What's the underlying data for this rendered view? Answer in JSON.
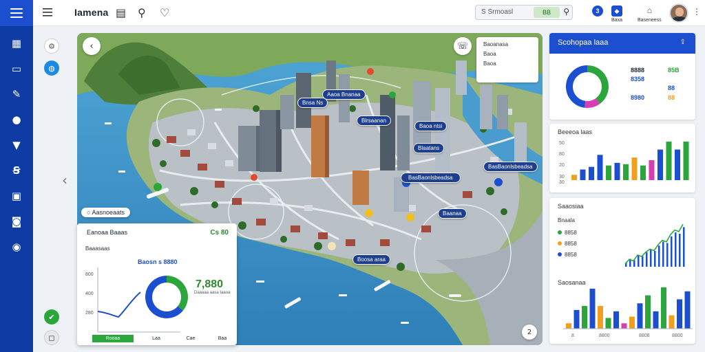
{
  "app": {
    "brand": "Iamena"
  },
  "header": {
    "search_placeholder": "S Srmoasl",
    "search_chip": "BB",
    "btn1_badge": "3",
    "btn2_label": "Baxa",
    "btn3_label": "Baseneess"
  },
  "map": {
    "labels": [
      "Aaoa Bnanaa",
      "Bnsa Ns",
      "Blrsaanan",
      "Baoa ntsi",
      "Blaatans",
      "BasBaonlsbeadsa",
      "Baanaa",
      "Boosa araa"
    ],
    "legend": [
      "Baoanasa",
      "Baoa",
      "Baoa"
    ],
    "tag": "Aasnoeaats",
    "zoom": "2"
  },
  "overlay": {
    "title": "Eanoaa Baaas",
    "value": "Cs 80",
    "subtitle": "Baaasaas",
    "chart_title": "Baosn s 8880",
    "y_ticks": [
      "800",
      "400",
      "280"
    ],
    "big_value": "7,880",
    "big_sub": "Daaaaa aasa taaoa",
    "tabs": [
      "Rooaa",
      "Laa",
      "Cae",
      "Baa"
    ]
  },
  "panel1": {
    "title": "Scohopaa laaa",
    "legend": [
      {
        "v": "8888",
        "c": "#1a1f2b"
      },
      {
        "v": "8358",
        "c": "#1b4fd0"
      },
      {
        "v": "8980",
        "c": "#1b4fd0"
      },
      {
        "v": "85B",
        "c": "#2ca53c"
      },
      {
        "v": "88",
        "c": "#1b4fd0"
      },
      {
        "v": "88",
        "c": "#f0a020"
      }
    ]
  },
  "panel2": {
    "title": "Beeeoa laas",
    "y_ticks": [
      "50",
      "80",
      "20",
      "30",
      "30"
    ]
  },
  "panel3": {
    "title": "Saaosiaa",
    "rows": [
      {
        "label": "Bnaala",
        "c": "#555"
      },
      {
        "label": "8858",
        "c": "#2ca53c"
      },
      {
        "label": "8858",
        "c": "#f0a020"
      },
      {
        "label": "8858",
        "c": "#1b4fd0"
      }
    ],
    "sub_title": "Saosanaa",
    "x_ticks": [
      "8",
      "8800",
      "8808",
      "8800"
    ]
  },
  "colors": {
    "primary": "#1b4fd0",
    "nav": "#0d3aa3",
    "green": "#2ca53c",
    "orange": "#f0a020",
    "magenta": "#d63fb3"
  },
  "chart_data": [
    {
      "type": "pie",
      "values": [
        40,
        12,
        48
      ],
      "colors": [
        "#2ca53c",
        "#d63fb3",
        "#1b4fd0"
      ]
    },
    {
      "type": "bar",
      "values": [
        4,
        8,
        10,
        19,
        11,
        13,
        12,
        17,
        11,
        15,
        23,
        29,
        23,
        29
      ],
      "colors": [
        "#f0a020",
        "#1b4fd0",
        "#1b4fd0",
        "#1b4fd0",
        "#2ca53c",
        "#1b4fd0",
        "#2ca53c",
        "#f0a020",
        "#2ca53c",
        "#d63fb3",
        "#1b4fd0",
        "#2ca53c",
        "#1b4fd0",
        "#2ca53c"
      ]
    },
    {
      "type": "line",
      "values": [
        2,
        5,
        4,
        8,
        7,
        10,
        12,
        11,
        15,
        18,
        17,
        22,
        25,
        24,
        29
      ],
      "bars": [
        3,
        6,
        5,
        9,
        8,
        11,
        13,
        12,
        16,
        19,
        18,
        23,
        26,
        25,
        30
      ]
    },
    {
      "type": "bar",
      "values": [
        4,
        14,
        17,
        30,
        17,
        8,
        13,
        4,
        9,
        19,
        25,
        13,
        31,
        10,
        22,
        28
      ],
      "colors": [
        "#f0a020",
        "#1b4fd0",
        "#2ca53c",
        "#1b4fd0",
        "#f0a020",
        "#2ca53c",
        "#1b4fd0",
        "#d63fb3",
        "#f0a020",
        "#1b4fd0",
        "#2ca53c",
        "#1b4fd0",
        "#2ca53c",
        "#f0a020",
        "#1b4fd0",
        "#1b4fd0"
      ]
    }
  ]
}
